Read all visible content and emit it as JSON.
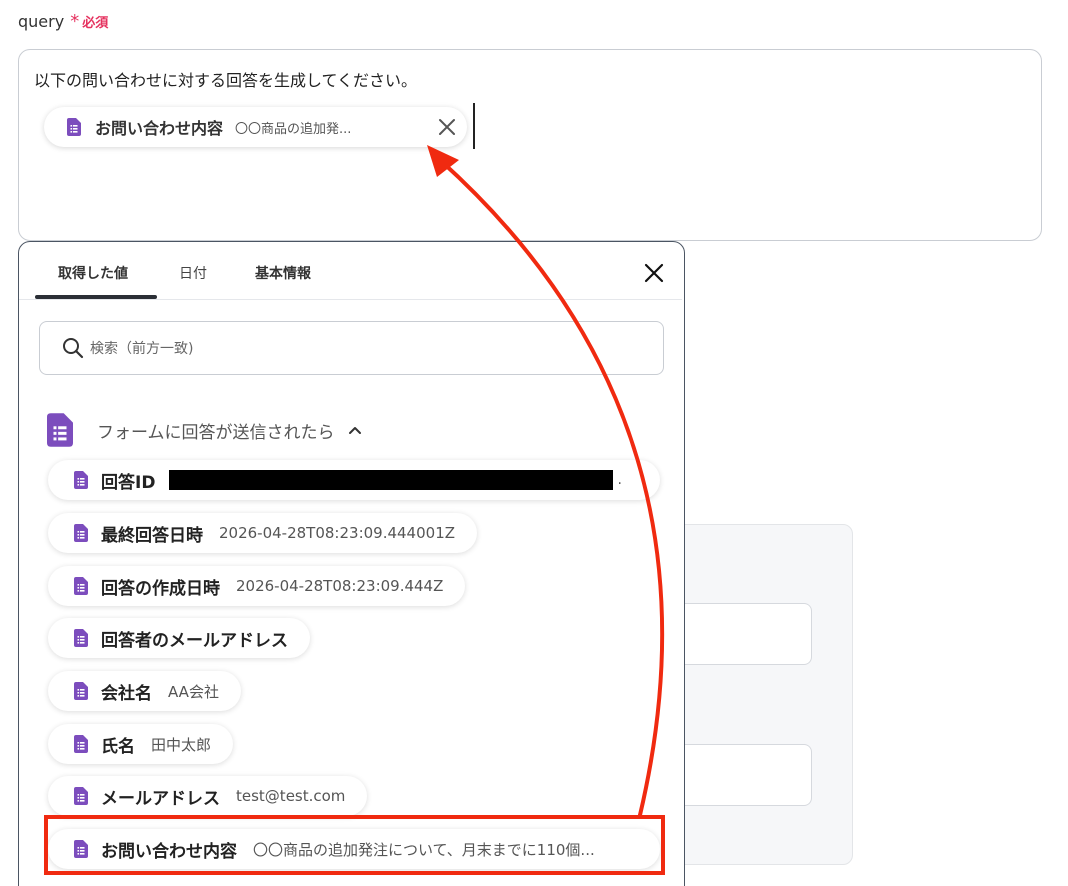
{
  "field": {
    "label": "query",
    "required_star": "*",
    "required_text": "必須"
  },
  "query": {
    "text": "以下の問い合わせに対する回答を生成してください。",
    "chip_label": "お問い合わせ内容",
    "chip_value": "〇〇商品の追加発..."
  },
  "tabs": [
    {
      "label": "取得した値",
      "active": true
    },
    {
      "label": "日付",
      "active": false
    },
    {
      "label": "基本情報",
      "active": false
    }
  ],
  "search": {
    "placeholder": "検索（前方一致)"
  },
  "group": {
    "label": "フォームに回答が送信されたら",
    "expanded": true
  },
  "items": [
    {
      "label": "回答ID",
      "value": "",
      "redacted": true,
      "trailing": "."
    },
    {
      "label": "最終回答日時",
      "value": "2026-04-28T08:23:09.444001Z"
    },
    {
      "label": "回答の作成日時",
      "value": "2026-04-28T08:23:09.444Z"
    },
    {
      "label": "回答者のメールアドレス",
      "value": ""
    },
    {
      "label": "会社名",
      "value": "AA会社"
    },
    {
      "label": "氏名",
      "value": "田中太郎"
    },
    {
      "label": "メールアドレス",
      "value": "test@test.com"
    },
    {
      "label": "お問い合わせ内容",
      "value": "〇〇商品の追加発注について、月末までに110個..."
    }
  ],
  "colors": {
    "accent_purple": "#7c4dbd",
    "required_red": "#e5325f",
    "annotation_red": "#f02a10"
  },
  "icons": {
    "item": "google-forms-doc-icon",
    "close": "close-icon",
    "search": "search-icon",
    "chevron": "chevron-up-icon"
  }
}
